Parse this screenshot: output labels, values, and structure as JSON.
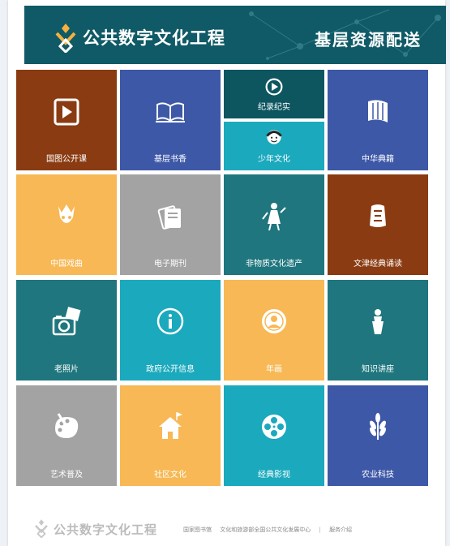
{
  "header": {
    "brand": "公共数字文化工程",
    "slogan": "基层资源配送"
  },
  "tiles": [
    {
      "label": "国图公开课",
      "icon": "play-card-icon",
      "color": "#8a3b12"
    },
    {
      "label": "基层书香",
      "icon": "open-book-icon",
      "color": "#3e58a8"
    },
    {
      "label": "纪录纪实",
      "icon": "play-circle-icon",
      "color": "#0d5660"
    },
    {
      "label": "少年文化",
      "icon": "child-face-icon",
      "color": "#1ba9bd"
    },
    {
      "label": "中华典籍",
      "icon": "scroll-icon",
      "color": "#3e58a8"
    },
    {
      "label": "中国戏曲",
      "icon": "opera-mask-icon",
      "color": "#f7b855"
    },
    {
      "label": "电子期刊",
      "icon": "magazine-icon",
      "color": "#a3a3a3"
    },
    {
      "label": "非物质文化遗产",
      "icon": "heritage-figure-icon",
      "color": "#1f767e"
    },
    {
      "label": "文津经典诵读",
      "icon": "classic-seal-icon",
      "color": "#8a3b12"
    },
    {
      "label": "老照片",
      "icon": "camera-photo-icon",
      "color": "#1f767e"
    },
    {
      "label": "政府公开信息",
      "icon": "info-icon",
      "color": "#1ba9bd"
    },
    {
      "label": "年画",
      "icon": "new-year-painting-icon",
      "color": "#f7b855"
    },
    {
      "label": "知识讲座",
      "icon": "lecturer-podium-icon",
      "color": "#1f767e"
    },
    {
      "label": "艺术普及",
      "icon": "palette-brush-icon",
      "color": "#a3a3a3"
    },
    {
      "label": "社区文化",
      "icon": "house-flag-icon",
      "color": "#f7b855"
    },
    {
      "label": "经典影视",
      "icon": "film-reel-icon",
      "color": "#1ba9bd"
    },
    {
      "label": "农业科技",
      "icon": "wheat-icon",
      "color": "#3e58a8"
    }
  ],
  "footer": {
    "brand": "公共数字文化工程",
    "links": [
      "国家图书馆",
      "文化和旅游部全国公共文化发展中心",
      "服务介绍"
    ],
    "separator": "|"
  }
}
